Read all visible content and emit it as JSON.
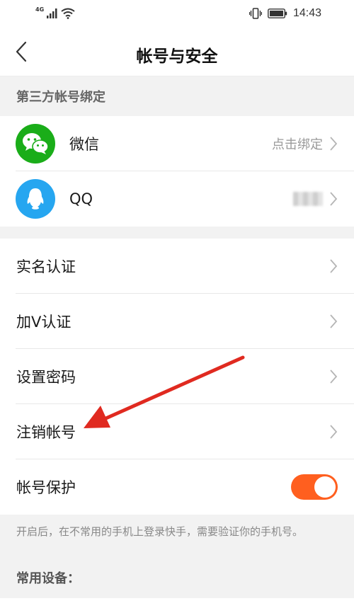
{
  "status_bar": {
    "network_label": "4G",
    "time": "14:43",
    "icons": [
      "signal-icon",
      "wifi-icon",
      "vibrate-icon",
      "battery-icon"
    ]
  },
  "nav": {
    "back_icon": "chevron-left-icon",
    "title": "帐号与安全"
  },
  "third_party": {
    "header": "第三方帐号绑定",
    "wechat": {
      "label": "微信",
      "action": "点击绑定",
      "icon": "wechat-icon",
      "color": "#1aad19"
    },
    "qq": {
      "label": "QQ",
      "icon": "qq-icon",
      "color": "#26a6f0"
    }
  },
  "settings": {
    "real_name": "实名认证",
    "verify_v": "加V认证",
    "set_password": "设置密码",
    "cancel_account": "注销帐号",
    "protection": {
      "label": "帐号保护",
      "enabled": true,
      "toggle_color": "#ff5f1f"
    }
  },
  "hint": "开启后，在不常用的手机上登录快手，需要验证你的手机号。",
  "common_devices": "常用设备："
}
